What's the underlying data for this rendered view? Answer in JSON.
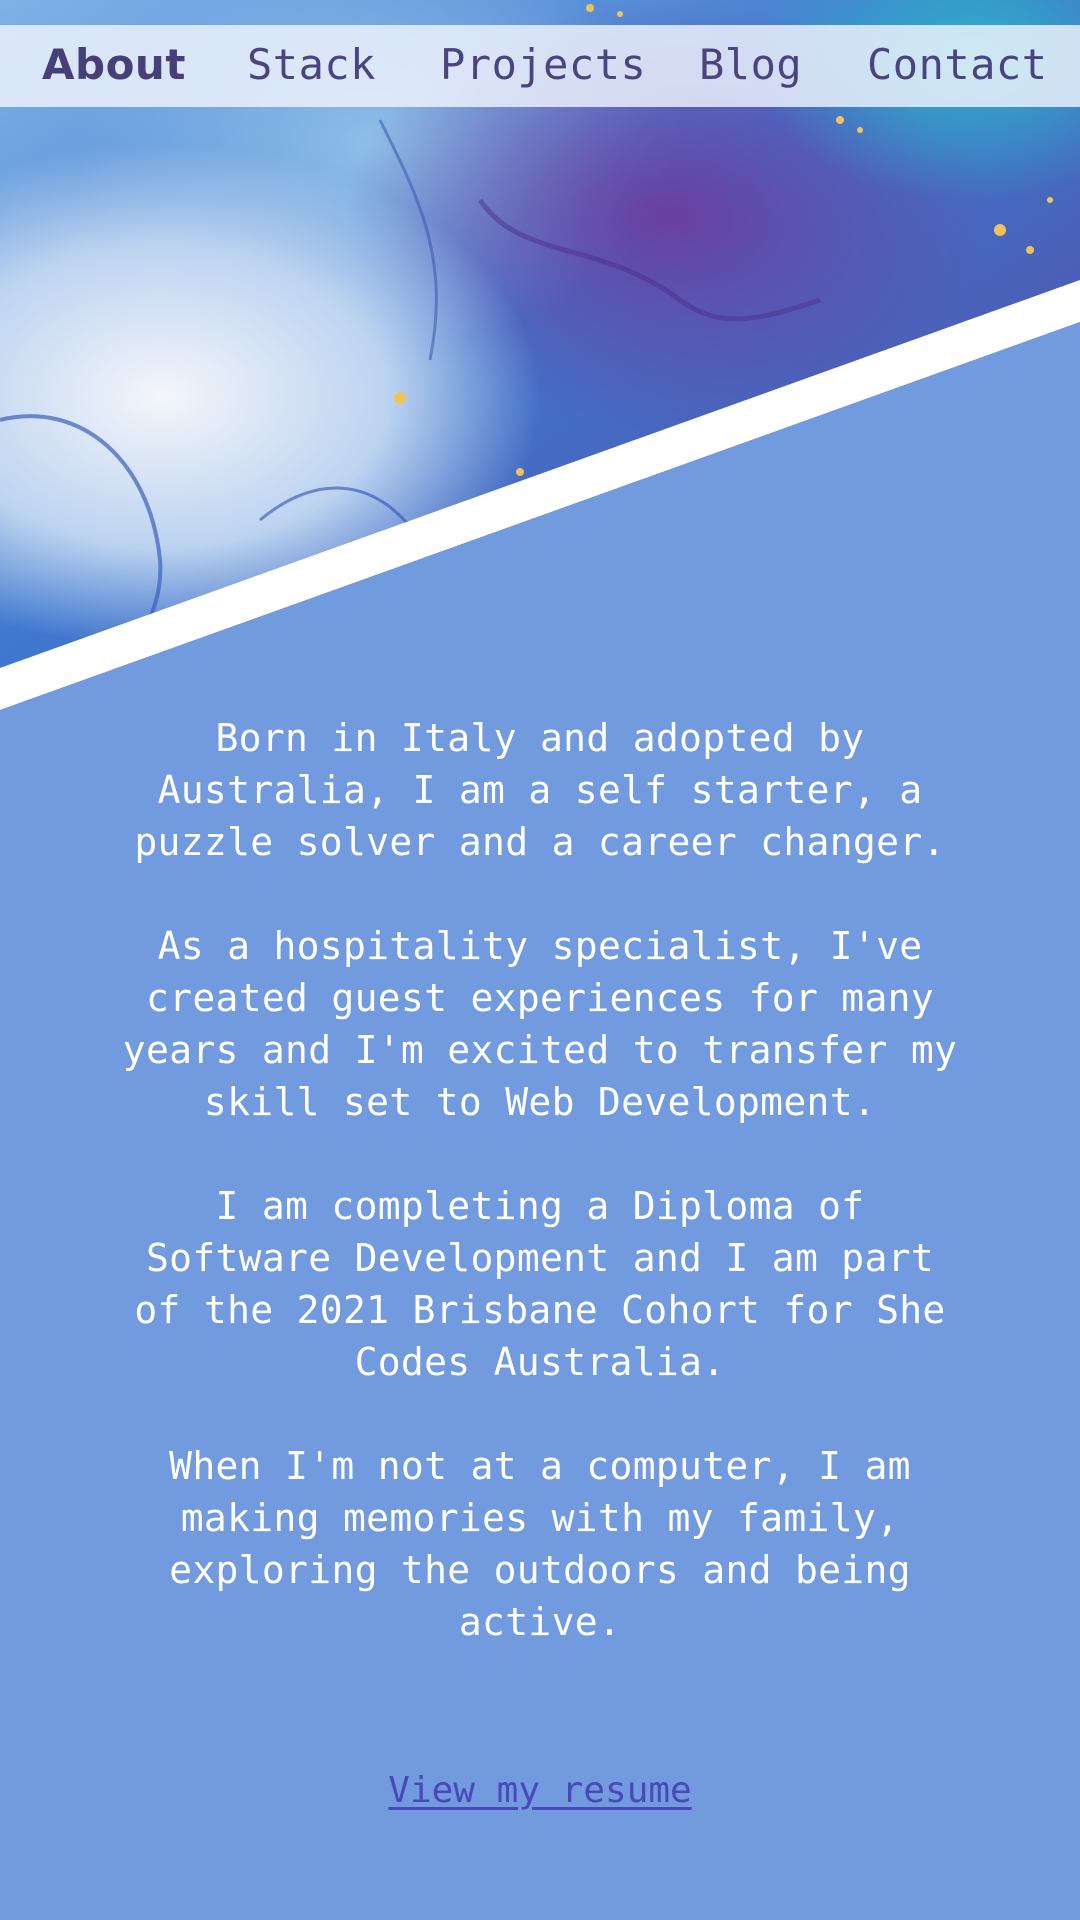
{
  "nav": {
    "items": [
      {
        "label": "About",
        "active": true
      },
      {
        "label": "Stack",
        "active": false
      },
      {
        "label": "Projects",
        "active": false
      },
      {
        "label": "Blog",
        "active": false
      },
      {
        "label": "Contact",
        "active": false
      }
    ]
  },
  "about": {
    "paragraphs": [
      "Born in Italy and adopted by Australia, I am a self starter, a puzzle solver and a career changer.",
      "As a hospitality specialist, I've created guest experiences for many years and I'm excited to transfer my skill set to Web Development.",
      "I am completing a Diploma of Software Development and I am part of the 2021 Brisbane Cohort for She Codes Australia.",
      "When I'm not at a computer, I am making memories with my family, exploring the outdoors and being active."
    ],
    "resume_link": "View my resume"
  },
  "colors": {
    "background": "#729ade",
    "nav_text": "#4a4580",
    "link": "#4b48b9",
    "body_text": "#ffffff"
  }
}
